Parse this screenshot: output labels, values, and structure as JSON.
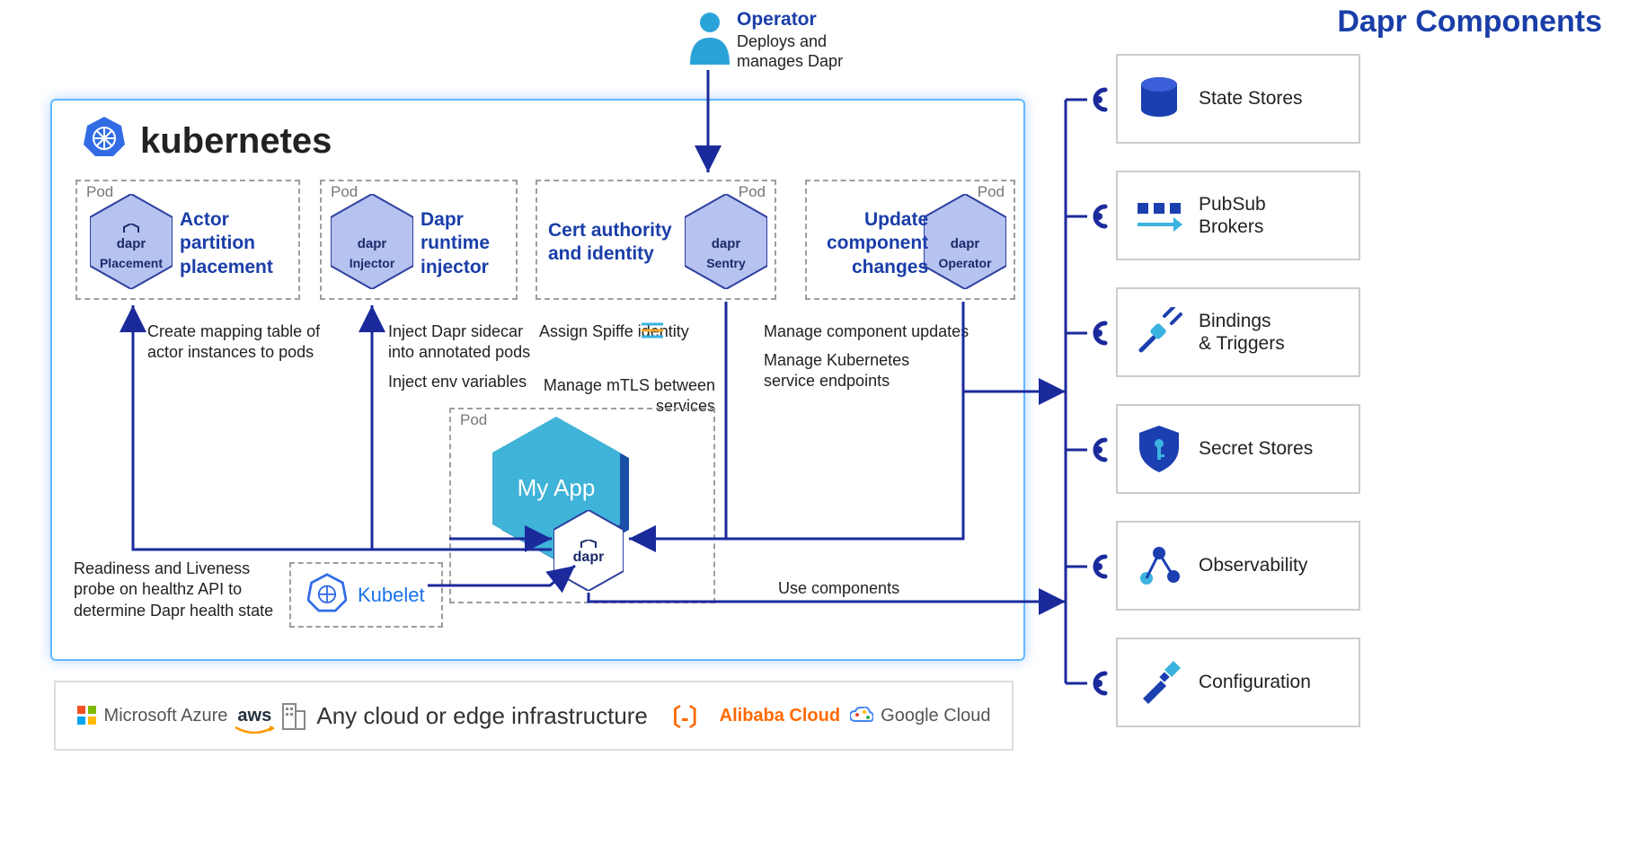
{
  "title": "kubernetes",
  "operator": {
    "title": "Operator",
    "sub1": "Deploys and",
    "sub2": "manages Dapr"
  },
  "pods": {
    "placement": {
      "label": "Pod",
      "hexTop": "dapr",
      "hexSub": "Placement",
      "text": "Actor\npartition\nplacement"
    },
    "injector": {
      "label": "Pod",
      "hexTop": "dapr",
      "hexSub": "Injector",
      "text": "Dapr\nruntime\ninjector"
    },
    "sentry": {
      "label": "Pod",
      "hexTop": "dapr",
      "hexSub": "Sentry",
      "text": "Cert authority\nand identity"
    },
    "operator": {
      "label": "Pod",
      "hexTop": "dapr",
      "hexSub": "Operator",
      "text": "Update\ncomponent\nchanges"
    },
    "app": {
      "label": "Pod",
      "appName": "My App",
      "sidecar": "dapr"
    }
  },
  "notes": {
    "placement": "Create mapping table of\nactor instances to pods",
    "injector1": "Inject Dapr sidecar\ninto annotated pods",
    "injector2": "Inject env variables",
    "sentry1": "Assign Spiffe     identity",
    "sentry2": "Manage mTLS between\nservices",
    "operator1": "Manage component updates",
    "operator2": "Manage Kubernetes\nservice endpoints",
    "kubelet": "Readiness and Liveness\nprobe on healthz API to\ndetermine Dapr health state",
    "usecomp": "Use components"
  },
  "kubelet": "Kubelet",
  "components_title": "Dapr Components",
  "components": [
    {
      "label": "State Stores"
    },
    {
      "label": "PubSub\nBrokers"
    },
    {
      "label": "Bindings\n& Triggers"
    },
    {
      "label": "Secret Stores"
    },
    {
      "label": "Observability"
    },
    {
      "label": "Configuration"
    }
  ],
  "footer": {
    "azure": "Microsoft Azure",
    "aws": "aws",
    "title": "Any cloud or edge infrastructure",
    "ali": "Alibaba Cloud",
    "gcp": "Google Cloud"
  }
}
